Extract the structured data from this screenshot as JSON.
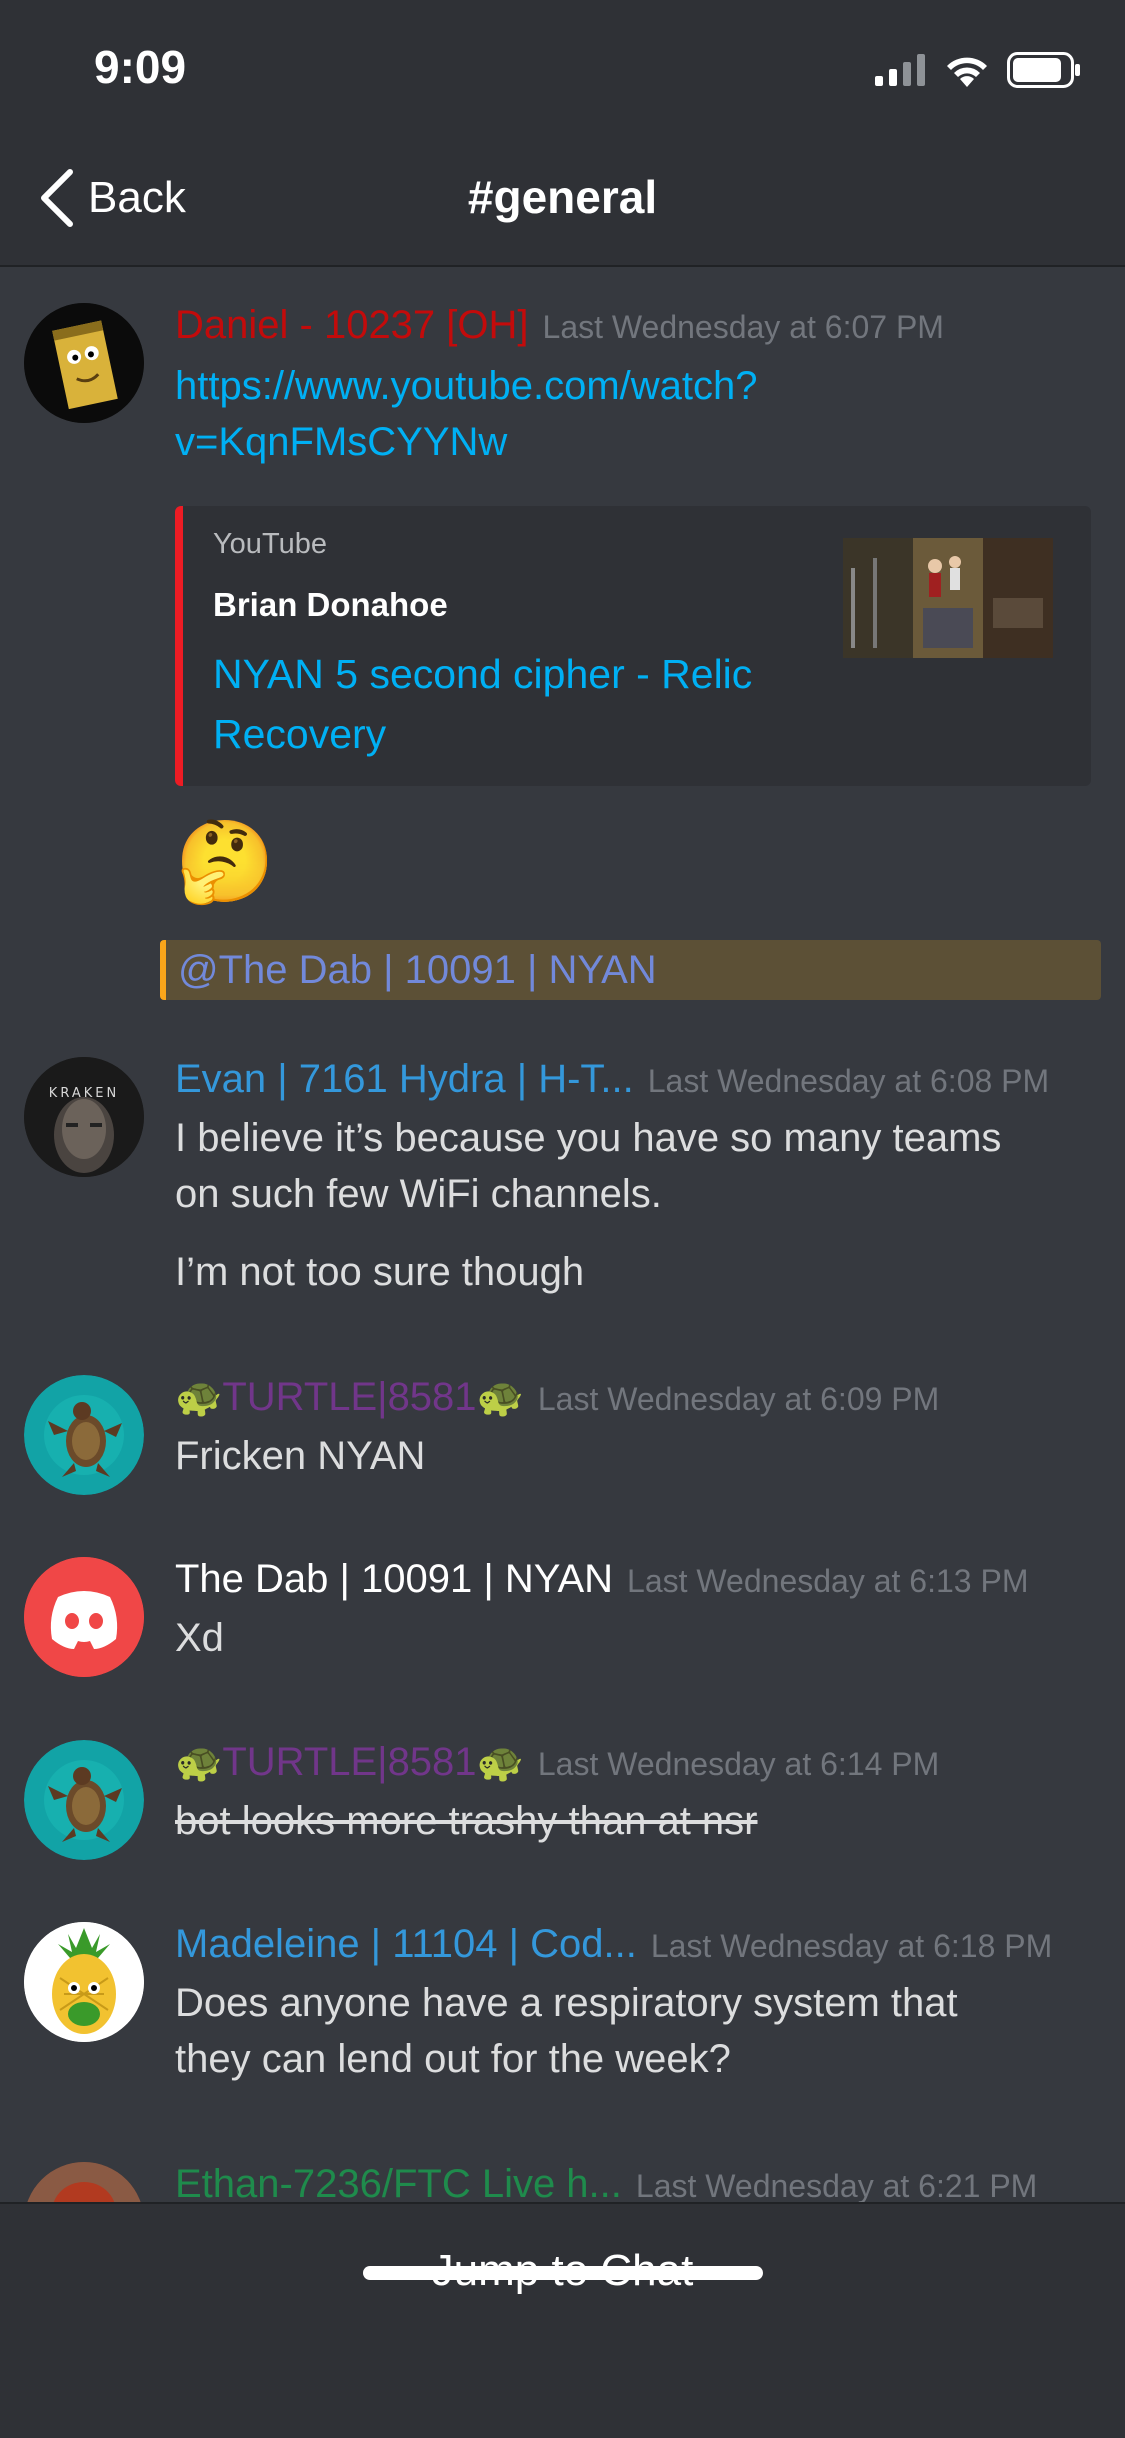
{
  "status_bar": {
    "time": "9:09"
  },
  "nav": {
    "back_label": "Back",
    "channel": "#general"
  },
  "messages": [
    {
      "author": "Daniel - 10237 [OH]",
      "author_color": "#c30b0b",
      "timestamp": "Last Wednesday at 6:07 PM",
      "link_line1": "https://www.youtube.com/watch?",
      "link_line2": "v=KqnFMsCYYNw",
      "embed": {
        "provider": "YouTube",
        "author": "Brian Donahoe",
        "title": "NYAN 5 second cipher - Relic Recovery",
        "accent": "#ed1c24"
      },
      "emoji": "🤔",
      "mention": "@The Dab | 10091 | NYAN"
    },
    {
      "author": "Evan | 7161 Hydra | H-T...",
      "author_color": "#3498db",
      "timestamp": "Last Wednesday at 6:08 PM",
      "line1": "I believe it’s because you have so many teams",
      "line2": "on such few WiFi channels.",
      "line3": "I’m not too sure though",
      "avatar_text": "KRAKEN"
    },
    {
      "author_prefix": "🐢",
      "author": "TURTLE|8581",
      "author_suffix": "🐢",
      "author_color": "#71368a",
      "timestamp": "Last Wednesday at 6:09 PM",
      "line1": "Fricken NYAN"
    },
    {
      "author": "The Dab | 10091 | NYAN",
      "author_color": "#ffffff",
      "timestamp": "Last Wednesday at 6:13 PM",
      "line1": "Xd"
    },
    {
      "author_prefix": "🐢",
      "author": "TURTLE|8581",
      "author_suffix": "🐢",
      "author_color": "#71368a",
      "timestamp": "Last Wednesday at 6:14 PM",
      "line1": "bot looks more trashy than at nsr"
    },
    {
      "author": "Madeleine | 11104 | Cod...",
      "author_color": "#3498db",
      "timestamp": "Last Wednesday at 6:18 PM",
      "line1": "Does anyone have a respiratory system that",
      "line2": "they can lend out for the week?"
    },
    {
      "author": "Ethan-7236/FTC Live h...",
      "author_color": "#1f8b4c",
      "timestamp": "Last Wednesday at 6:21 PM"
    }
  ],
  "footer": {
    "jump_label": "Jump to Chat"
  }
}
